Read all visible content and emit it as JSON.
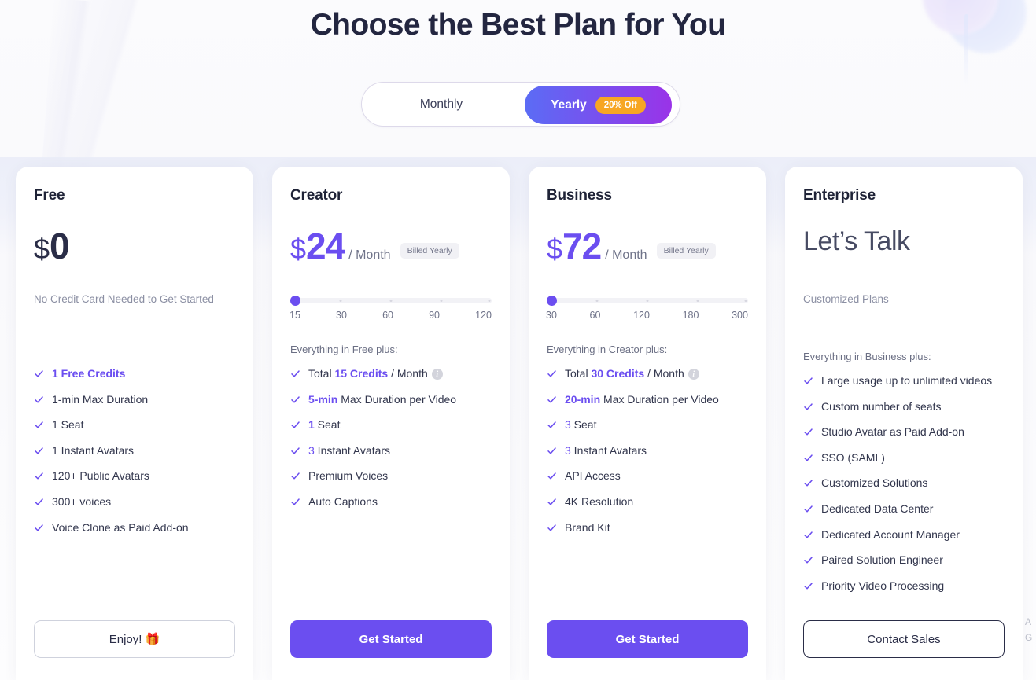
{
  "header": {
    "title": "Choose the Best Plan for You"
  },
  "billing_toggle": {
    "monthly_label": "Monthly",
    "yearly_label": "Yearly",
    "discount_badge": "20% Off",
    "selected": "Yearly"
  },
  "colors": {
    "brand_purple": "#6b4ef0",
    "gradient_start": "#5b6cf5",
    "gradient_end": "#9a33e8",
    "badge_orange": "#f7a623",
    "text_dark": "#2a2d47",
    "text_muted": "#8b8fa3"
  },
  "plans": [
    {
      "name": "Free",
      "currency": "$",
      "amount": "0",
      "period": "",
      "billed_note": "",
      "sub_note": "No Credit Card Needed to Get Started",
      "features_intro": "",
      "features": [
        {
          "text": "1 Free Credits",
          "style": "all-brand"
        },
        {
          "text": "1-min Max Duration",
          "style": "plain"
        },
        {
          "text": "1 Seat",
          "style": "plain"
        },
        {
          "text": "1 Instant Avatars",
          "style": "plain"
        },
        {
          "text": "120+ Public Avatars",
          "style": "plain"
        },
        {
          "text": "300+ voices",
          "style": "plain"
        },
        {
          "text": "Voice Clone as Paid Add-on",
          "style": "plain"
        }
      ],
      "cta_label": "Enjoy! 🎁",
      "cta_type": "outline"
    },
    {
      "name": "Creator",
      "currency": "$",
      "amount": "24",
      "period": "/ Month",
      "billed_note": "Billed Yearly",
      "sub_note": "",
      "slider": {
        "ticks": [
          "15",
          "30",
          "60",
          "90",
          "120"
        ],
        "selected_index": 0
      },
      "features_intro": "Everything in Free plus:",
      "features": [
        {
          "prefix": "Total ",
          "highlight": "15 Credits",
          "suffix": " / Month",
          "info": true
        },
        {
          "highlight_lead": "5-min",
          "suffix": " Max Duration per Video"
        },
        {
          "highlight_lead": "1",
          "suffix": " Seat"
        },
        {
          "highlight_lead": "3",
          "suffix": " Instant Avatars"
        },
        {
          "text": "Premium Voices",
          "style": "plain"
        },
        {
          "text": "Auto Captions",
          "style": "plain"
        }
      ],
      "cta_label": "Get Started",
      "cta_type": "filled"
    },
    {
      "name": "Business",
      "currency": "$",
      "amount": "72",
      "period": "/ Month",
      "billed_note": "Billed Yearly",
      "sub_note": "",
      "slider": {
        "ticks": [
          "30",
          "60",
          "120",
          "180",
          "300"
        ],
        "selected_index": 0
      },
      "features_intro": "Everything in Creator plus:",
      "features": [
        {
          "prefix": "Total ",
          "highlight": "30 Credits",
          "suffix": " / Month",
          "info": true
        },
        {
          "highlight_lead": "20-min",
          "suffix": " Max Duration per Video"
        },
        {
          "highlight_lead": "3",
          "suffix": " Seat"
        },
        {
          "highlight_lead": "3",
          "suffix": " Instant Avatars"
        },
        {
          "text": "API Access",
          "style": "plain"
        },
        {
          "text": "4K Resolution",
          "style": "plain"
        },
        {
          "text": "Brand Kit",
          "style": "plain"
        }
      ],
      "cta_label": "Get Started",
      "cta_type": "filled"
    },
    {
      "name": "Enterprise",
      "currency": "",
      "amount": "",
      "headline_price": "Let’s Talk",
      "period": "",
      "billed_note": "",
      "sub_note": "Customized Plans",
      "features_intro": "Everything in Business plus:",
      "features": [
        {
          "text": "Large usage up to unlimited videos",
          "style": "plain"
        },
        {
          "text": "Custom number of seats",
          "style": "plain"
        },
        {
          "text": "Studio Avatar as Paid Add-on",
          "style": "plain"
        },
        {
          "text": "SSO (SAML)",
          "style": "plain"
        },
        {
          "text": "Customized Solutions",
          "style": "plain"
        },
        {
          "text": "Dedicated Data Center",
          "style": "plain"
        },
        {
          "text": "Dedicated Account Manager",
          "style": "plain"
        },
        {
          "text": "Paired Solution Engineer",
          "style": "plain"
        },
        {
          "text": "Priority Video Processing",
          "style": "plain"
        }
      ],
      "cta_label": "Contact Sales",
      "cta_type": "outline-dark"
    }
  ],
  "edge_widget": {
    "line1": "A",
    "line2": "G"
  }
}
